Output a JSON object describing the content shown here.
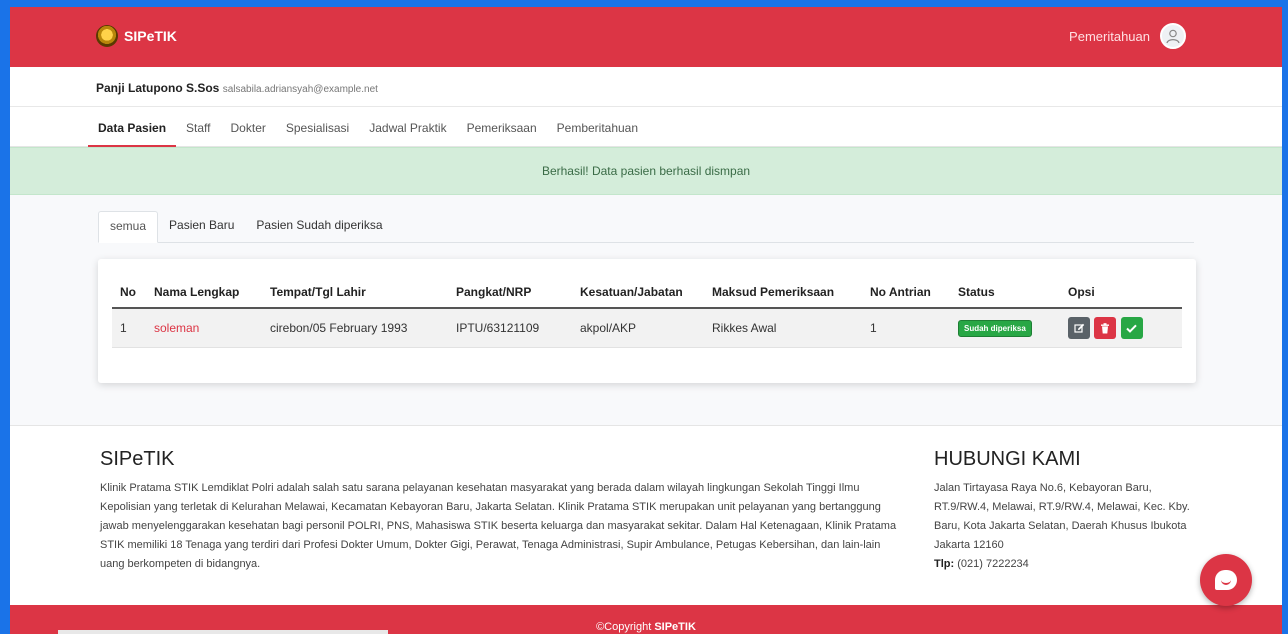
{
  "header": {
    "brand": "SIPeTIK",
    "notification_label": "Pemeritahuan"
  },
  "user": {
    "name": "Panji Latupono S.Sos",
    "email": "salsabila.adriansyah@example.net"
  },
  "nav": {
    "items": [
      "Data Pasien",
      "Staff",
      "Dokter",
      "Spesialisasi",
      "Jadwal Praktik",
      "Pemeriksaan",
      "Pemberitahuan"
    ],
    "active": "Data Pasien"
  },
  "alert": {
    "message": "Berhasil! Data pasien berhasil dismpan",
    "color": "#d4edda"
  },
  "tabs": {
    "items": [
      "semua",
      "Pasien Baru",
      "Pasien Sudah diperiksa"
    ],
    "active": "semua"
  },
  "table": {
    "columns": [
      "No",
      "Nama Lengkap",
      "Tempat/Tgl Lahir",
      "Pangkat/NRP",
      "Kesatuan/Jabatan",
      "Maksud Pemeriksaan",
      "No Antrian",
      "Status",
      "Opsi"
    ],
    "rows": [
      {
        "no": "1",
        "nama": "soleman",
        "ttl": "cirebon/05 February 1993",
        "pangkat": "IPTU/63121109",
        "kesatuan": "akpol/AKP",
        "maksud": "Rikkes Awal",
        "antrian": "1",
        "status": "Sudah diperiksa"
      }
    ],
    "options": [
      "edit-icon",
      "trash-icon",
      "check-icon"
    ]
  },
  "footer": {
    "about_title": "SIPeTIK",
    "about_text": "Klinik Pratama STIK Lemdiklat Polri adalah salah satu sarana pelayanan kesehatan masyarakat yang berada dalam wilayah lingkungan Sekolah Tinggi Ilmu Kepolisian yang terletak di Kelurahan Melawai, Kecamatan Kebayoran Baru, Jakarta Selatan. Klinik Pratama STIK merupakan unit pelayanan yang bertanggung jawab menyelenggarakan kesehatan bagi personil POLRI, PNS, Mahasiswa STIK beserta keluarga dan masyarakat sekitar. Dalam Hal Ketenagaan, Klinik Pratama STIK memiliki 18 Tenaga yang terdiri dari Profesi Dokter Umum, Dokter Gigi, Perawat, Tenaga Administrasi, Supir Ambulance, Petugas Kebersihan, dan lain-lain uang berkompeten di bidangnya.",
    "contact_title": "HUBUNGI KAMI",
    "address": "Jalan Tirtayasa Raya No.6, Kebayoran Baru, RT.9/RW.4, Melawai, RT.9/RW.4, Melawai, Kec. Kby. Baru, Kota Jakarta Selatan, Daerah Khusus Ibukota Jakarta 12160",
    "phone_label": "Tlp:",
    "phone": "(021) 7222234",
    "copyright_prefix": "©Copyright",
    "copyright_brand": "SIPeTIK"
  },
  "colors": {
    "primary": "#dc3545",
    "success": "#28a745",
    "frame": "#1a73e8"
  }
}
